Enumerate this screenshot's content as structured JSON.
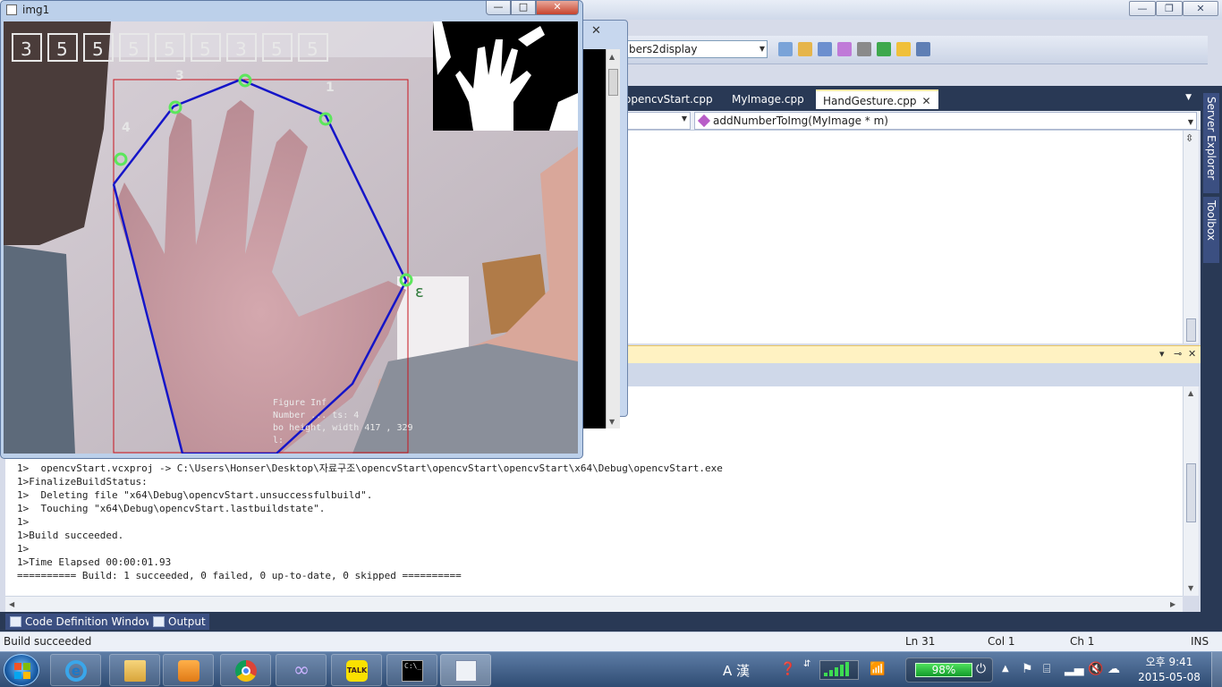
{
  "image_window": {
    "title": "img1",
    "minimize": "—",
    "maximize": "□",
    "close": "✕",
    "finger_counter_digits": [
      "3",
      "5",
      "5",
      "5",
      "5",
      "5",
      "3",
      "5",
      "5"
    ],
    "finger_labels": [
      "3",
      "4",
      "1"
    ],
    "overlay_text": {
      "line1": "Figure Inf",
      "line2": "Number   ...  ts: 4",
      "line3": "bo     height, width 417 , 329",
      "line4": "l:"
    }
  },
  "console": {
    "close_glyph": "✕"
  },
  "vs": {
    "title_buttons": {
      "minimize": "—",
      "maximize": "❐",
      "close": "✕"
    },
    "toolbar_combo": "bers2display",
    "tabs": [
      "opencvStart.cpp",
      "MyImage.cpp",
      "HandGesture.cpp"
    ],
    "tab_close": "✕",
    "nav_function": "addNumberToImg(MyImage * m)",
    "side_tabs": [
      "Server Explorer",
      "Toolbox"
    ],
    "output_header_buttons": {
      "dropdown": "▾",
      "pin": "⊸",
      "close": "✕"
    },
    "output_lines": [
      "1>  opencvStart.vcxproj -> C:\\Users\\Honser\\Desktop\\자료구조\\opencvStart\\opencvStart\\opencvStart\\x64\\Debug\\opencvStart.exe",
      "1>FinalizeBuildStatus:",
      "1>  Deleting file \"x64\\Debug\\opencvStart.unsuccessfulbuild\".",
      "1>  Touching \"x64\\Debug\\opencvStart.lastbuildstate\".",
      "1>",
      "1>Build succeeded.",
      "1>",
      "1>Time Elapsed 00:00:01.93",
      "========== Build: 1 succeeded, 0 failed, 0 up-to-date, 0 skipped =========="
    ],
    "bottom_tabs": [
      "Code Definition Window",
      "Output"
    ],
    "status": {
      "message": "Build succeeded",
      "line": "Ln 31",
      "col": "Col 1",
      "ch": "Ch 1",
      "mode": "INS"
    }
  },
  "taskbar": {
    "ime": "A 漢",
    "battery": "98%",
    "time": "오후 9:41",
    "date": "2015-05-08",
    "console_label": "C:\\_",
    "kakao_label": "TALK"
  },
  "colors": {
    "vs_dark": "#293955",
    "hull_line": "#1515c8",
    "fingertip": "#5ce65c",
    "roi_box": "#c8141e"
  }
}
